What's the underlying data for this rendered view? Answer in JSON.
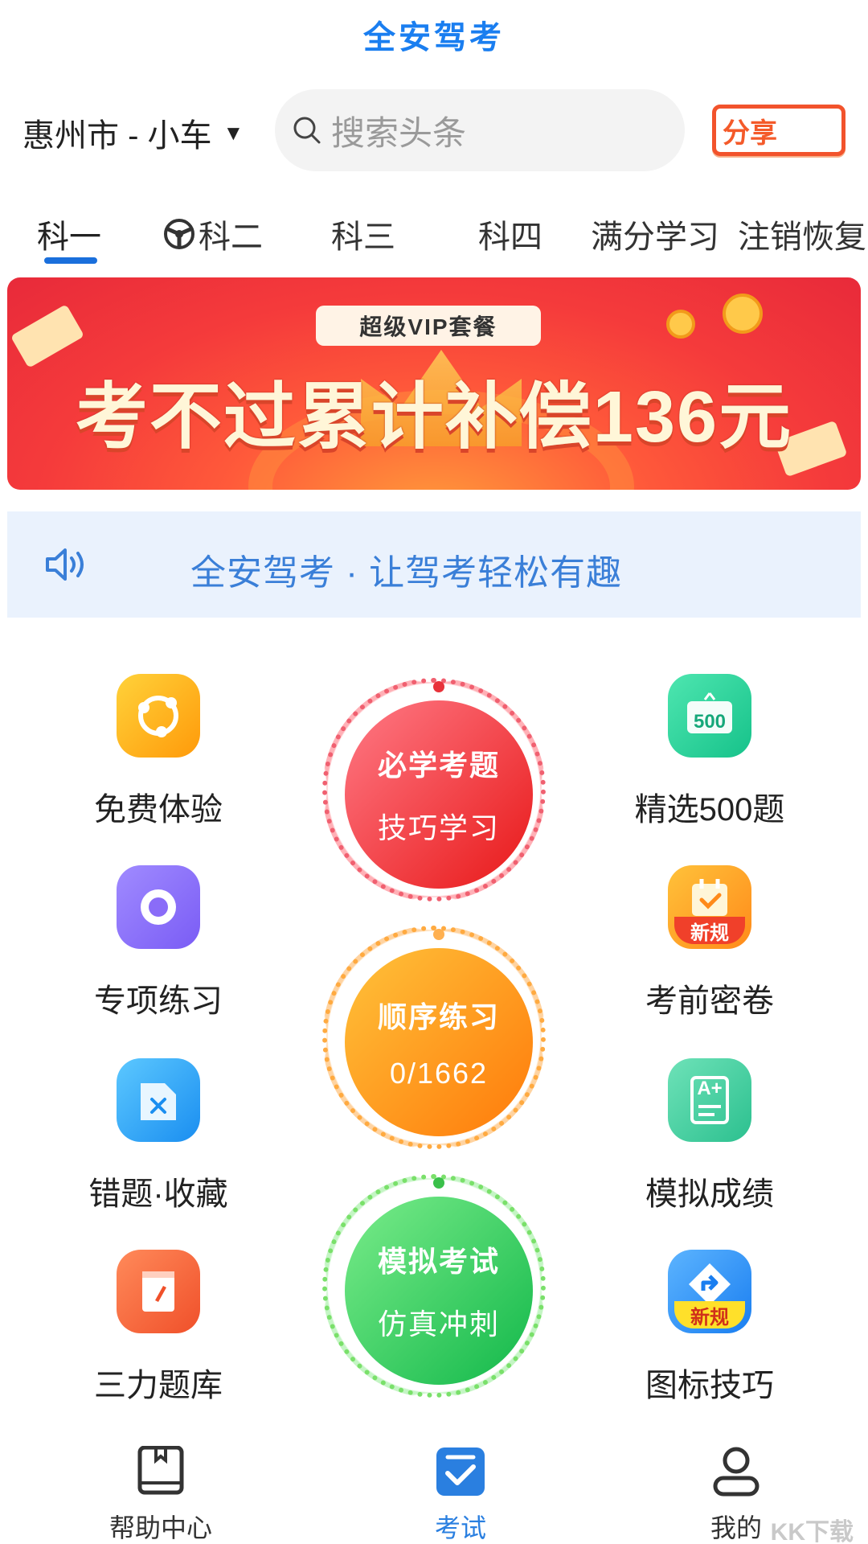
{
  "app": {
    "title": "全安驾考"
  },
  "topbar": {
    "city": "惠州市 - 小车",
    "caret": "▼",
    "search_placeholder": "搜索头条",
    "share_label": "分享"
  },
  "tabs": [
    {
      "label": "科一",
      "active": true
    },
    {
      "label": "科二",
      "active": false
    },
    {
      "label": "科三",
      "active": false
    },
    {
      "label": "科四",
      "active": false
    },
    {
      "label": "满分学习",
      "active": false
    },
    {
      "label": "注销恢复",
      "active": false
    }
  ],
  "banner": {
    "pill": "超级VIP套餐",
    "headline": "考不过累计补偿136元"
  },
  "notice": {
    "text": "全安驾考 · 让驾考轻松有趣"
  },
  "features_left": [
    {
      "label": "免费体验",
      "icon": "share-nodes-icon"
    },
    {
      "label": "专项练习",
      "icon": "target-icon"
    },
    {
      "label": "错题·收藏",
      "icon": "wrong-question-icon"
    },
    {
      "label": "三力题库",
      "icon": "notebook-icon"
    }
  ],
  "features_right": [
    {
      "label": "精选500题",
      "icon": "500-board-icon",
      "badge": "500"
    },
    {
      "label": "考前密卷",
      "icon": "calendar-check-icon",
      "badge": "新规"
    },
    {
      "label": "模拟成绩",
      "icon": "grade-doc-icon",
      "badge": "A+"
    },
    {
      "label": "图标技巧",
      "icon": "road-sign-icon",
      "badge": "新规"
    }
  ],
  "circles": [
    {
      "line1": "必学考题",
      "line2": "技巧学习"
    },
    {
      "line1": "顺序练习",
      "line2": "0/1662"
    },
    {
      "line1": "模拟考试",
      "line2": "仿真冲刺"
    }
  ],
  "bottom_nav": [
    {
      "label": "帮助中心",
      "icon": "book-icon",
      "active": false
    },
    {
      "label": "考试",
      "icon": "exam-check-icon",
      "active": true
    },
    {
      "label": "我的",
      "icon": "user-icon",
      "active": false
    }
  ],
  "watermark": "KK下载",
  "colors": {
    "primary": "#1a7ef0",
    "red_circle": "#ee3a3a",
    "orange_circle": "#ff9a1a",
    "green_circle": "#2ec95a"
  }
}
